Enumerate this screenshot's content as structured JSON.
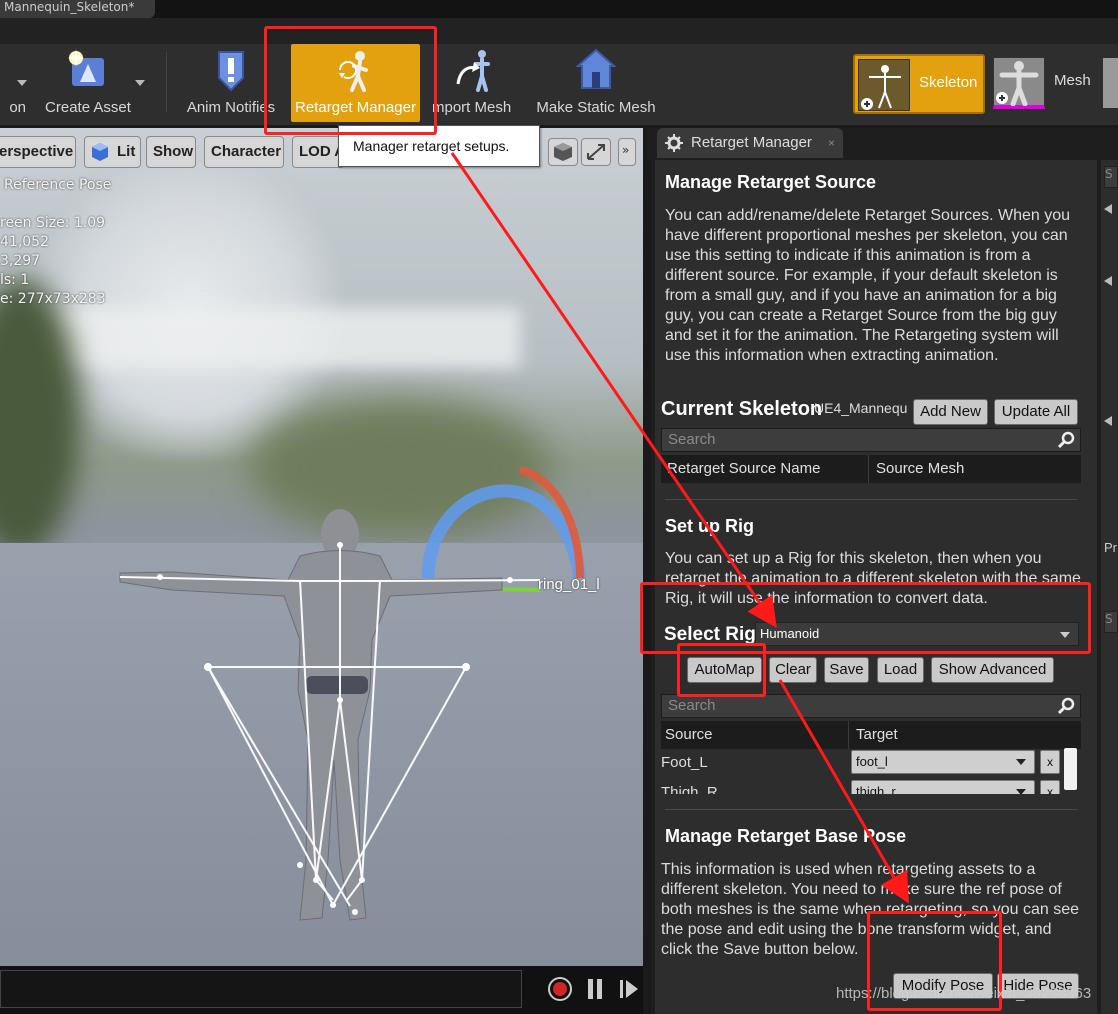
{
  "title_tab": "Mannequin_Skeleton*",
  "toolbar": {
    "items": [
      {
        "label": "on",
        "icon": "import-icon"
      },
      {
        "label": "Create Asset",
        "icon": "create-asset-icon"
      },
      {
        "label": "Anim Notifies",
        "icon": "anim-notifies-icon"
      },
      {
        "label": "Retarget Manager",
        "icon": "retarget-manager-icon"
      },
      {
        "label": "mport Mesh",
        "icon": "import-mesh-icon"
      },
      {
        "label": "Make Static Mesh",
        "icon": "make-static-mesh-icon"
      }
    ],
    "modes": {
      "skeleton": "Skeleton",
      "mesh": "Mesh"
    },
    "accent": "#e3a10f"
  },
  "tooltip": "Manager retarget setups.",
  "viewport": {
    "buttons": [
      "erspective",
      "Lit",
      "Show",
      "Character",
      "LOD A"
    ],
    "stats": [
      "Reference Pose",
      "reen Size: 1.09",
      "41,052",
      "3,297",
      "ls: 1",
      "e: 277x73x283"
    ],
    "bone_label": "ring_01_l"
  },
  "panel": {
    "tab": "Retarget Manager",
    "manage_source": {
      "title": "Manage Retarget Source",
      "text": "You can add/rename/delete Retarget Sources. When you have different proportional meshes per skeleton, you can use this setting to indicate if this animation is from a different source. For example, if your default skeleton is from a small guy, and if you have an animation for a big guy, you can create a Retarget Source from the big guy and set it for the animation. The Retargeting system will use this information when extracting animation."
    },
    "current_skeleton": {
      "label": "Current Skeleton",
      "value": "UE4_Mannequ",
      "add_new": "Add New",
      "update_all": "Update All",
      "search_placeholder": "Search",
      "columns": [
        "Retarget Source Name",
        "Source Mesh"
      ]
    },
    "setup_rig": {
      "title": "Set up Rig",
      "text": "You can set up a Rig for this skeleton, then when you retarget the animation to a different skeleton with the same Rig, it will use the information to convert data.",
      "select_label": "Select Rig",
      "selected": "Humanoid",
      "buttons": {
        "automap": "AutoMap",
        "clear": "Clear",
        "save": "Save",
        "load": "Load",
        "show_advanced": "Show Advanced"
      },
      "search_placeholder": "Search",
      "columns": [
        "Source",
        "Target"
      ],
      "rows": [
        {
          "source": "Foot_L",
          "target": "foot_l"
        },
        {
          "source": "Thigh_R",
          "target": "thigh_r"
        }
      ]
    },
    "base_pose": {
      "title": "Manage Retarget Base Pose",
      "text": "This information is used when retargeting assets to a different skeleton. You need to make sure the ref pose of both meshes is the same when retargeting, so you can see the pose and edit using the bone transform widget, and click the Save button below.",
      "modify": "Modify Pose",
      "hide": "Hide Pose"
    }
  },
  "far_right": {
    "chip": "S",
    "label": "Pr"
  },
  "watermark": "https://blog.csdn.net/weixin_38298363"
}
